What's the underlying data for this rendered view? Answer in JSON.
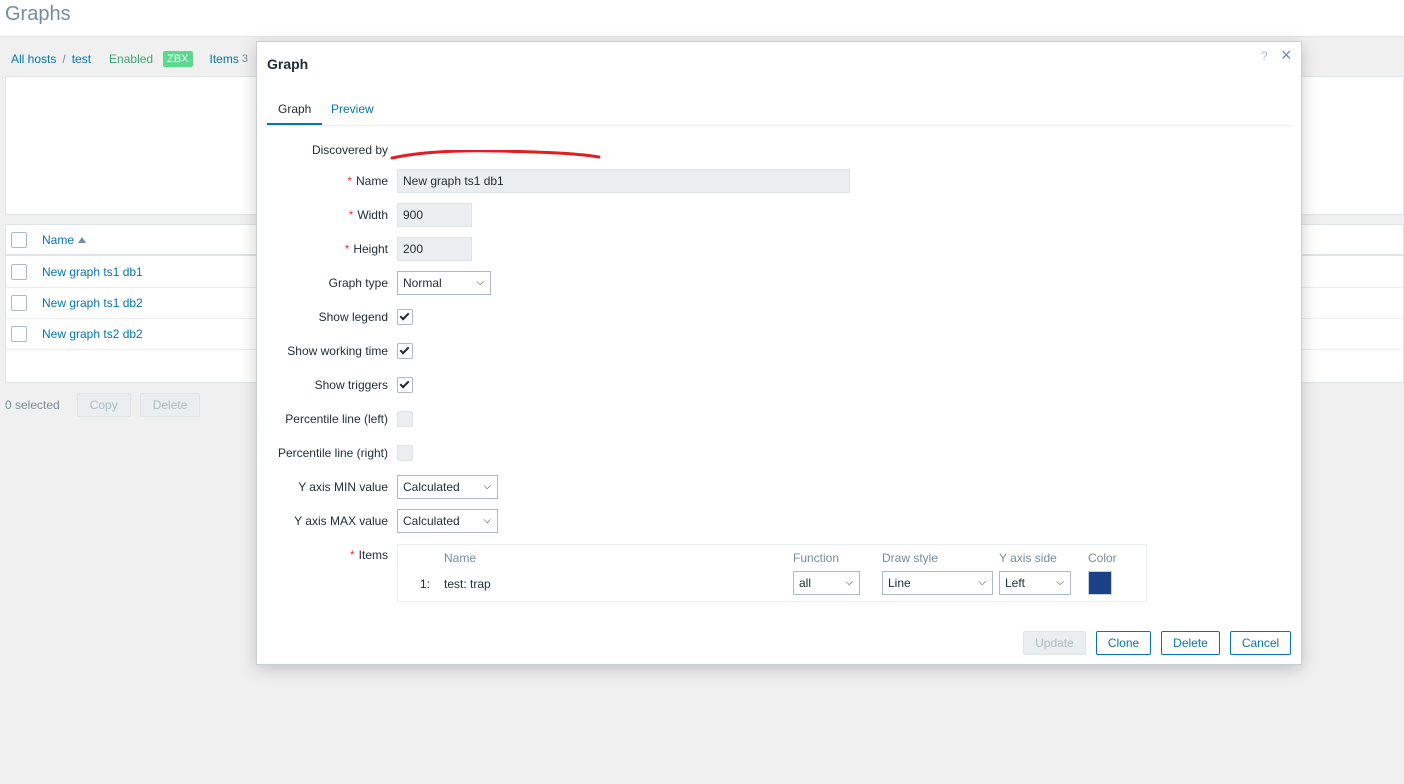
{
  "page": {
    "title": "Graphs",
    "breadcrumb": {
      "all_hosts": "All hosts",
      "separator": "/",
      "host": "test"
    },
    "status": {
      "enabled": "Enabled",
      "zbx": "ZBX",
      "items_label": "Items",
      "items_count": "3"
    },
    "table": {
      "name_header": "Name",
      "rows": [
        {
          "name": "New graph ts1 db1"
        },
        {
          "name": "New graph ts1 db2"
        },
        {
          "name": "New graph ts2 db2"
        }
      ]
    },
    "footer": {
      "selected": "0 selected",
      "copy": "Copy",
      "delete": "Delete"
    }
  },
  "dialog": {
    "title": "Graph",
    "help": "?",
    "close": "×",
    "tabs": [
      {
        "label": "Graph",
        "active": true
      },
      {
        "label": "Preview",
        "active": false
      }
    ],
    "form": {
      "discovered_by_label": "Discovered by",
      "name_label": "Name",
      "name_value": "New graph ts1 db1",
      "width_label": "Width",
      "width_value": "900",
      "height_label": "Height",
      "height_value": "200",
      "graph_type_label": "Graph type",
      "graph_type_value": "Normal",
      "show_legend_label": "Show legend",
      "show_legend": true,
      "show_working_time_label": "Show working time",
      "show_working_time": true,
      "show_triggers_label": "Show triggers",
      "show_triggers": true,
      "percentile_left_label": "Percentile line (left)",
      "percentile_left": false,
      "percentile_right_label": "Percentile line (right)",
      "percentile_right": false,
      "ymin_label": "Y axis MIN value",
      "ymin_value": "Calculated",
      "ymax_label": "Y axis MAX value",
      "ymax_value": "Calculated",
      "items_label": "Items",
      "required_mark": "*"
    },
    "items": {
      "headers": {
        "name": "Name",
        "function": "Function",
        "draw_style": "Draw style",
        "y_axis_side": "Y axis side",
        "color": "Color"
      },
      "rows": [
        {
          "index": "1:",
          "name": "test: trap",
          "function": "all",
          "draw_style": "Line",
          "y_axis_side": "Left",
          "color": "#1a4187"
        }
      ]
    },
    "buttons": {
      "update": "Update",
      "clone": "Clone",
      "delete": "Delete",
      "cancel": "Cancel"
    },
    "annotation_color": "#e02020"
  }
}
